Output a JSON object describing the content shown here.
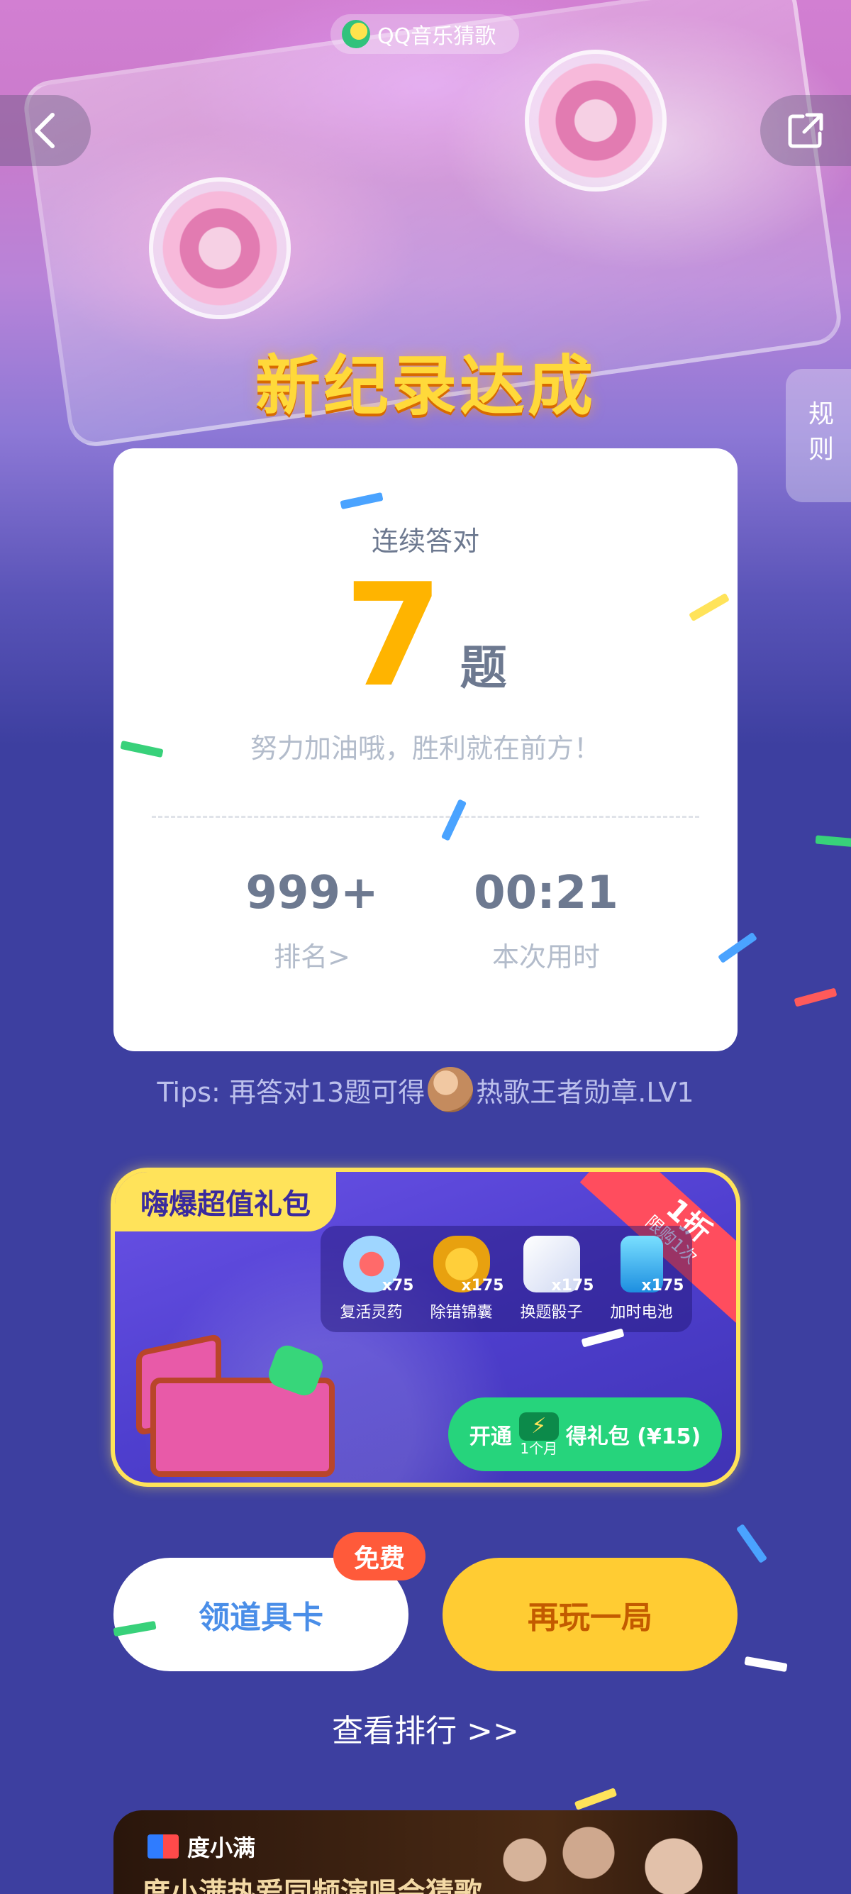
{
  "app": {
    "name": "QQ音乐猜歌"
  },
  "header": {
    "rules_label": "规则"
  },
  "result": {
    "title": "新纪录达成",
    "streak_label": "连续答对",
    "streak_count": "7",
    "streak_unit": "题",
    "encouragement": "努力加油哦，胜利就在前方！",
    "rank_value": "999+",
    "rank_label": "排名>",
    "time_value": "00:21",
    "time_label": "本次用时"
  },
  "tips": {
    "prefix": "Tips: 再答对13题可得",
    "medal_name": "热歌王者勋章.LV1"
  },
  "gift_pack": {
    "title": "嗨爆超值礼包",
    "discount": "1折",
    "limit": "限购1次",
    "items": [
      {
        "name": "复活灵药",
        "count": "x75",
        "icon": "potion-icon"
      },
      {
        "name": "除错锦囊",
        "count": "x175",
        "icon": "pouch-icon"
      },
      {
        "name": "换题骰子",
        "count": "x175",
        "icon": "dice-icon"
      },
      {
        "name": "加时电池",
        "count": "x175",
        "icon": "battery-icon"
      }
    ],
    "buy_prefix": "开通",
    "buy_badge": "1个月",
    "buy_suffix": "得礼包 (¥15)"
  },
  "actions": {
    "free_badge": "免费",
    "card_label": "领道具卡",
    "replay_label": "再玩一局",
    "rank_link": "查看排行 >>"
  },
  "ad": {
    "brand": "度小满",
    "headline": "度小满热爱同频演唱会猜歌"
  },
  "colors": {
    "accent_yellow": "#ffcc33",
    "streak_orange": "#ffb400",
    "buy_green": "#26d47c",
    "badge_red": "#ff5a3a",
    "page_bg": "#3d3fa0"
  }
}
